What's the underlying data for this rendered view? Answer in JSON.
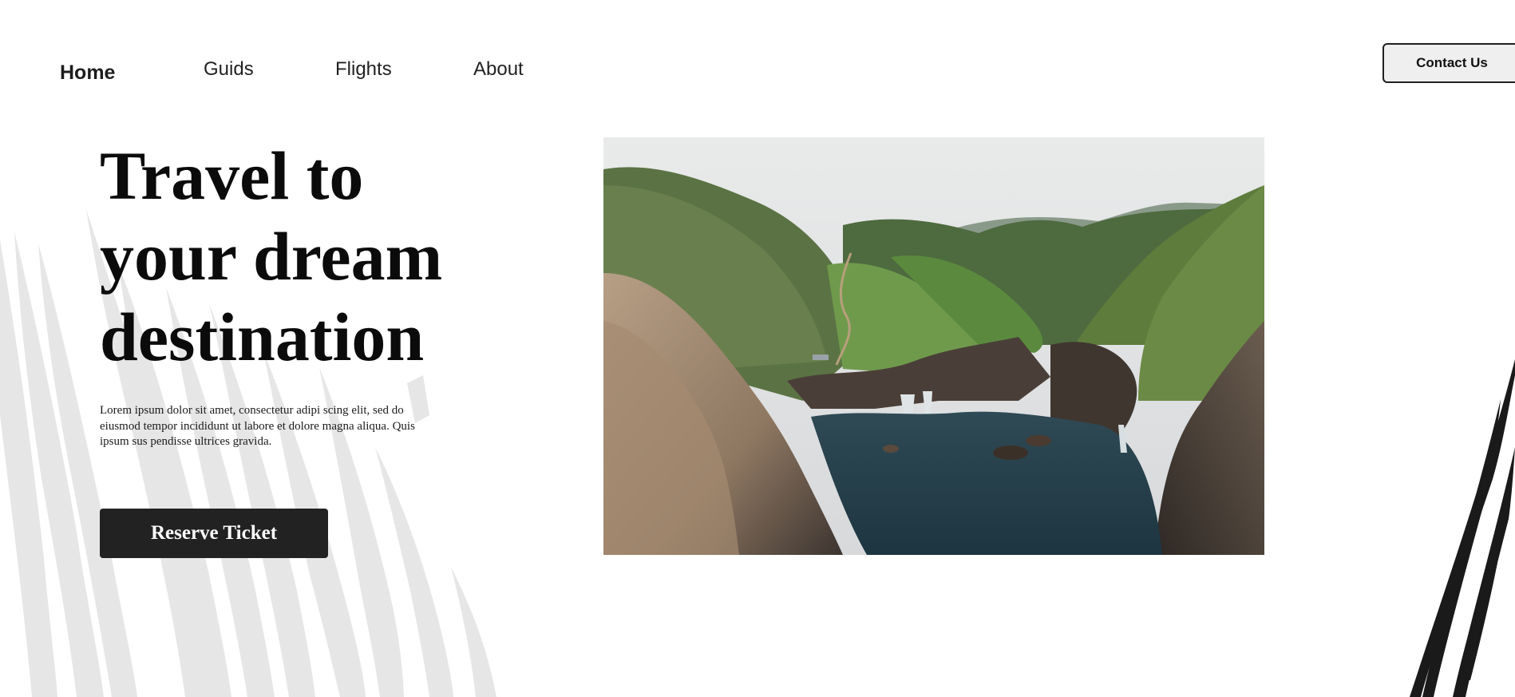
{
  "nav": {
    "items": [
      {
        "label": "Home",
        "active": true
      },
      {
        "label": "Guids",
        "active": false
      },
      {
        "label": "Flights",
        "active": false
      },
      {
        "label": "About",
        "active": false
      }
    ],
    "contact_label": "Contact Us"
  },
  "hero": {
    "title_lines": [
      "Travel to",
      "your dream",
      "destination"
    ],
    "description_lines": [
      "Lorem ipsum dolor sit amet, consectetur adipi scing elit, sed do",
      "eiusmod tempor incididunt ut labore et dolore magna aliqua. Quis",
      "ipsum sus pendisse ultrices gravida."
    ],
    "cta_label": "Reserve Ticket"
  },
  "colors": {
    "text": "#0b0b0b",
    "button_dark": "#222222",
    "contact_bg": "#efefef",
    "brush_light": "#e6e6e6",
    "brush_dark": "#1a1a1a"
  }
}
